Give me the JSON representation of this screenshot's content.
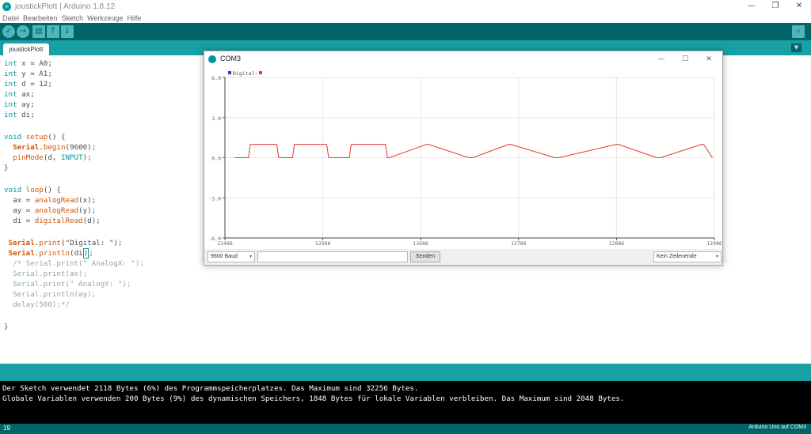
{
  "window": {
    "title": "joustickPlott | Arduino 1.8.12",
    "app_logo": "∞",
    "controls": {
      "minimize": "—",
      "maximize": "❐",
      "close": "✕"
    }
  },
  "menu": [
    "Datei",
    "Bearbeiten",
    "Sketch",
    "Werkzeuge",
    "Hilfe"
  ],
  "toolbar": {
    "verify": "✓",
    "upload": "→",
    "new": "▤",
    "open": "↑",
    "save": "↓",
    "serial_monitor": "⌕"
  },
  "tab": {
    "label": "joustickPlott",
    "menu_glyph": "▼"
  },
  "code": {
    "l1": {
      "kw": "int",
      "rest": " x = A0;"
    },
    "l2": {
      "kw": "int",
      "rest": " y = A1;"
    },
    "l3": {
      "kw": "int",
      "rest": " d = 12;"
    },
    "l4": {
      "kw": "int",
      "rest": " ax;"
    },
    "l5": {
      "kw": "int",
      "rest": " ay;"
    },
    "l6": {
      "kw": "int",
      "rest": " di;"
    },
    "l8": {
      "kw": "void",
      "fn": " setup",
      "rest": "() {"
    },
    "l9": {
      "indent": "  ",
      "obj": "Serial",
      "dot": ".",
      "fn": "begin",
      "rest": "(9600);"
    },
    "l10": {
      "indent": "  ",
      "fn": "pinMode",
      "pre": "(d, ",
      "kw": "INPUT",
      "rest": ");"
    },
    "l11": "}",
    "l13": {
      "kw": "void",
      "fn": " loop",
      "rest": "() {"
    },
    "l14": {
      "pre": "  ax = ",
      "fn": "analogRead",
      "rest": "(x);"
    },
    "l15": {
      "pre": "  ay = ",
      "fn": "analogRead",
      "rest": "(y);"
    },
    "l16": {
      "pre": "  di = ",
      "fn": "digitalRead",
      "rest": "(d);"
    },
    "l18": {
      "indent": " ",
      "obj": "Serial",
      "dot": ".",
      "fn": "print",
      "rest": "(\"Digital: \");"
    },
    "l19": {
      "indent": " ",
      "obj": "Serial",
      "dot": ".",
      "fn": "println",
      "pre": "(di",
      "caret": ")",
      "rest": ";"
    },
    "l20": "  /* Serial.print(\" AnalogX: \");",
    "l21": "  Serial.print(ax);",
    "l22": "  Serial.print(\" AnalogY: \");",
    "l23": "  Serial.println(ay);",
    "l24": "  delay(500);*/",
    "l26": "}"
  },
  "console": {
    "line1": "Der Sketch verwendet 2118 Bytes (6%) des Programmspeicherplatzes. Das Maximum sind 32256 Bytes.",
    "line2": "Globale Variablen verwenden 200 Bytes (9%) des dynamischen Speichers, 1848 Bytes für lokale Variablen verbleiben. Das Maximum sind 2048 Bytes."
  },
  "status": {
    "line": "19",
    "board": "Arduino Uno auf COM3"
  },
  "plotter": {
    "title": "COM3",
    "controls": {
      "minimize": "—",
      "maximize": "☐",
      "close": "✕"
    },
    "baud": "9600 Baud",
    "input_value": "",
    "send_label": "Senden",
    "line_ending": "Kein Zeilenende",
    "dropdown_glyph": "▾"
  },
  "chart_data": {
    "type": "line",
    "ylim": [
      -6.0,
      6.0
    ],
    "y_ticks": [
      "6.0",
      "3.0",
      "0.0",
      "-3.0",
      "-6.0"
    ],
    "y_tick_values": [
      6.0,
      3.0,
      0.0,
      -3.0,
      -6.0
    ],
    "x_ticks": [
      "12486",
      "12586",
      "12686",
      "12786",
      "12886",
      "12986"
    ],
    "x_tick_values": [
      12486,
      12586,
      12686,
      12786,
      12886,
      12986
    ],
    "xlim": [
      12486,
      12986
    ],
    "grid": true,
    "legend": "top-left",
    "legend_blue_color": "#1a3cd8",
    "series": [
      {
        "name": "Digital:",
        "color": "#e8362d",
        "x": [
          12496,
          12510,
          12512,
          12514,
          12539,
          12541,
          12543,
          12555,
          12557,
          12590,
          12592,
          12594,
          12613,
          12615,
          12650,
          12652,
          12654,
          12692,
          12694,
          12735,
          12737,
          12739,
          12776,
          12778,
          12823,
          12825,
          12827,
          12886,
          12888,
          12927,
          12929,
          12931,
          12973,
          12975,
          12984
        ],
        "values": [
          0,
          0,
          1,
          1,
          1,
          0,
          0,
          0,
          1,
          1,
          0,
          0,
          0,
          1,
          1,
          0,
          0,
          1,
          1,
          0,
          0,
          0,
          1,
          1,
          0,
          0,
          0,
          1,
          1,
          0,
          0,
          0,
          1,
          1,
          0
        ]
      }
    ]
  }
}
